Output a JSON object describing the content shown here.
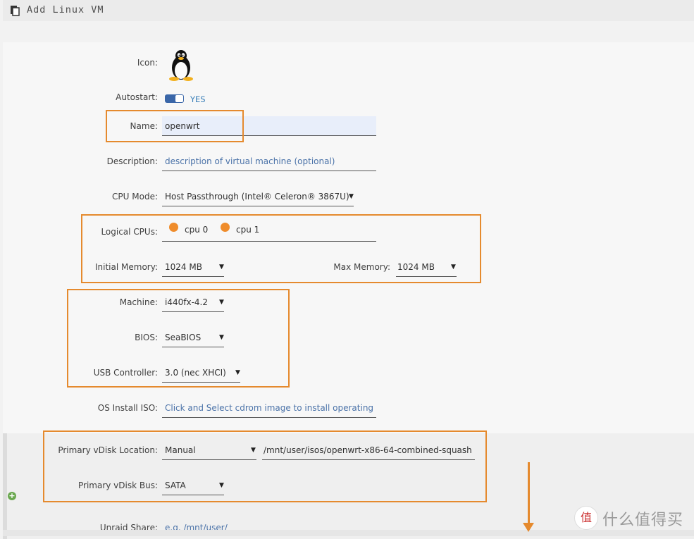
{
  "header": {
    "title": "Add Linux VM",
    "icon": "clipboard-icon"
  },
  "form": {
    "icon_label": "Icon:",
    "autostart_label": "Autostart:",
    "autostart_value": "YES",
    "name_label": "Name:",
    "name_value": "openwrt",
    "description_label": "Description:",
    "description_placeholder": "description of virtual machine (optional)",
    "cpu_mode_label": "CPU Mode:",
    "cpu_mode_value": "Host Passthrough (Intel® Celeron® 3867U)",
    "logical_cpus_label": "Logical CPUs:",
    "cpu0": "cpu 0",
    "cpu1": "cpu 1",
    "initial_memory_label": "Initial Memory:",
    "initial_memory_value": "1024 MB",
    "max_memory_label": "Max Memory:",
    "max_memory_value": "1024 MB",
    "machine_label": "Machine:",
    "machine_value": "i440fx-4.2",
    "bios_label": "BIOS:",
    "bios_value": "SeaBIOS",
    "usb_label": "USB Controller:",
    "usb_value": "3.0 (nec XHCI)",
    "os_iso_label": "OS Install ISO:",
    "os_iso_placeholder": "Click and Select cdrom image to install operating sy",
    "vdisk_location_label": "Primary vDisk Location:",
    "vdisk_location_value": "Manual",
    "vdisk_path": "/mnt/user/isos/openwrt-x86-64-combined-squash",
    "vdisk_bus_label": "Primary vDisk Bus:",
    "vdisk_bus_value": "SATA",
    "unraid_share_label": "Unraid Share:",
    "unraid_share_placeholder": "e.g. /mnt/user/"
  },
  "watermark": {
    "logo": "值",
    "text": "什么值得买"
  },
  "colors": {
    "highlight": "#e58a2e",
    "accent": "#3a66a8",
    "cpu_selected": "#ef8c2b"
  }
}
